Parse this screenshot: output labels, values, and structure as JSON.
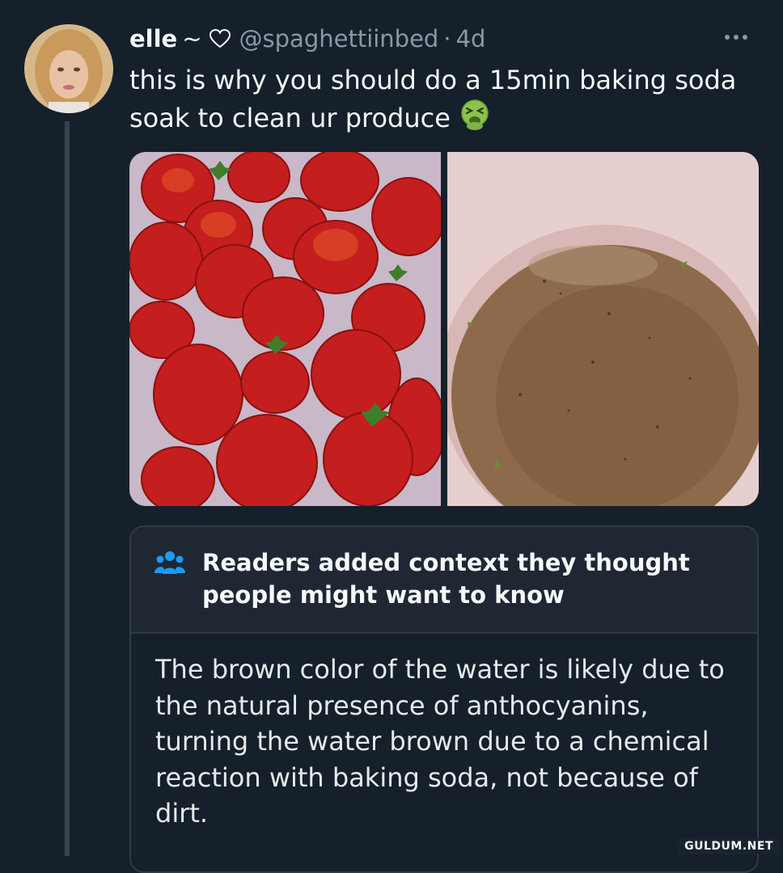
{
  "tweet": {
    "author_name": "elle",
    "name_suffix": "~",
    "handle": "@spaghettiinbed",
    "separator": "·",
    "time": "4d",
    "text": "this is why you should do a 15min baking soda soak to clean ur produce",
    "emoji": "nauseated-face-emoji"
  },
  "media": [
    {
      "alt": "strawberries soaking in water",
      "icon": "photo-strawberries"
    },
    {
      "alt": "bowl of brownish water",
      "icon": "photo-brown-water"
    }
  ],
  "community_note": {
    "title": "Readers added context they thought people might want to know",
    "body": "The brown color of the water is likely due to the natural presence of anthocyanins, turning the water brown due to a chemical reaction with baking soda, not because of dirt.",
    "icon": "people-icon"
  },
  "watermark": "GULDUM.NET",
  "colors": {
    "background": "#15202b",
    "secondary_text": "#8b98a5",
    "note_header": "#1e2732",
    "accent": "#1d9bf0"
  }
}
